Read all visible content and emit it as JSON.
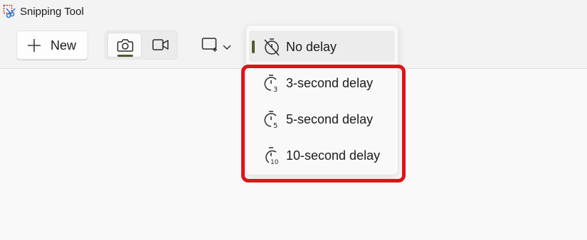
{
  "app": {
    "title": "Snipping Tool",
    "icon": "snipping-tool-icon"
  },
  "toolbar": {
    "new_label": "New",
    "new_icon": "plus-icon",
    "modes": [
      {
        "name": "snip",
        "icon": "camera-icon",
        "selected": true
      },
      {
        "name": "record",
        "icon": "video-camera-icon",
        "selected": false
      }
    ],
    "shape_icon": "rectangle-snip-icon",
    "shape_dropdown_icon": "chevron-down-icon"
  },
  "delay_menu": {
    "items": [
      {
        "label": "No delay",
        "icon": "timer-off-icon",
        "selected": true
      },
      {
        "label": "3-second delay",
        "icon": "timer-3-icon",
        "selected": false
      },
      {
        "label": "5-second delay",
        "icon": "timer-5-icon",
        "selected": false
      },
      {
        "label": "10-second delay",
        "icon": "timer-10-icon",
        "selected": false
      }
    ]
  },
  "colors": {
    "accent": "#4f5a2a",
    "highlight": "#e0121a",
    "toolbar_bg": "#f3f3f3",
    "content_bg": "#f9f9f9"
  }
}
